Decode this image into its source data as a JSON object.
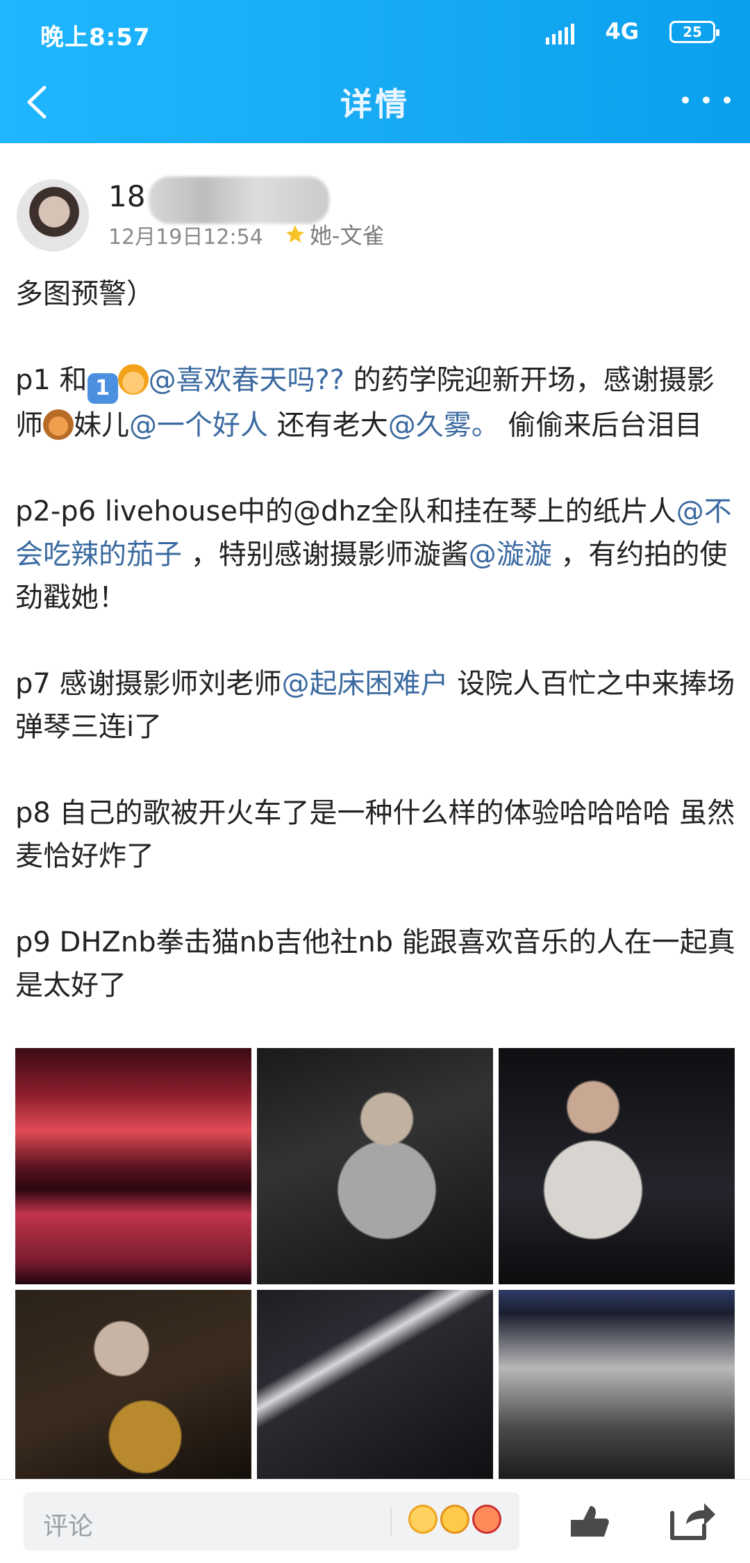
{
  "status": {
    "time": "晚上8:57",
    "network": "4G",
    "battery": "25"
  },
  "nav": {
    "title": "详情"
  },
  "author": {
    "name_prefix": "18",
    "date": "12月19日12:54",
    "tag": "她-文雀"
  },
  "post": {
    "line_intro": "多图预警）",
    "p1": {
      "a": "p1  和",
      "mention1": "@喜欢春天吗??",
      "b": " 的药学院迎新开场，感谢摄影师",
      "c": "妹儿",
      "mention2": "@一个好人",
      "d": "  还有老大",
      "mention3": "@久雾。",
      "e": " 偷偷来后台泪目"
    },
    "p2": {
      "a": "p2-p6 livehouse中的@dhz全队和挂在琴上的纸片人",
      "mention1": "@不会吃辣的茄子",
      "b": " ，特别感谢摄影师漩酱",
      "mention2": "@漩漩",
      "c": " ，有约拍的使劲戳她！"
    },
    "p7": {
      "a": "p7 感谢摄影师刘老师",
      "mention1": "@起床困难户",
      "b": " 设院人百忙之中来捧场 弹琴三连i了"
    },
    "p8": "p8 自己的歌被开火车了是一种什么样的体验哈哈哈哈 虽然麦恰好炸了",
    "p9": "p9 DHZnb拳击猫nb吉他社nb 能跟喜欢音乐的人在一起真是太好了"
  },
  "photos": [
    {
      "name": "photo-1",
      "icon": "stage-photo"
    },
    {
      "name": "photo-2",
      "icon": "guitarist-photo"
    },
    {
      "name": "photo-3",
      "icon": "keyboard-photo"
    },
    {
      "name": "photo-4",
      "icon": "saxophone-photo"
    },
    {
      "name": "photo-5",
      "icon": "bass-photo"
    },
    {
      "name": "photo-6",
      "icon": "band-photo"
    }
  ],
  "bottom": {
    "comment_placeholder": "评论"
  },
  "colors": {
    "header_blue": "#16a9f1",
    "mention_blue": "#3b6aa0"
  }
}
